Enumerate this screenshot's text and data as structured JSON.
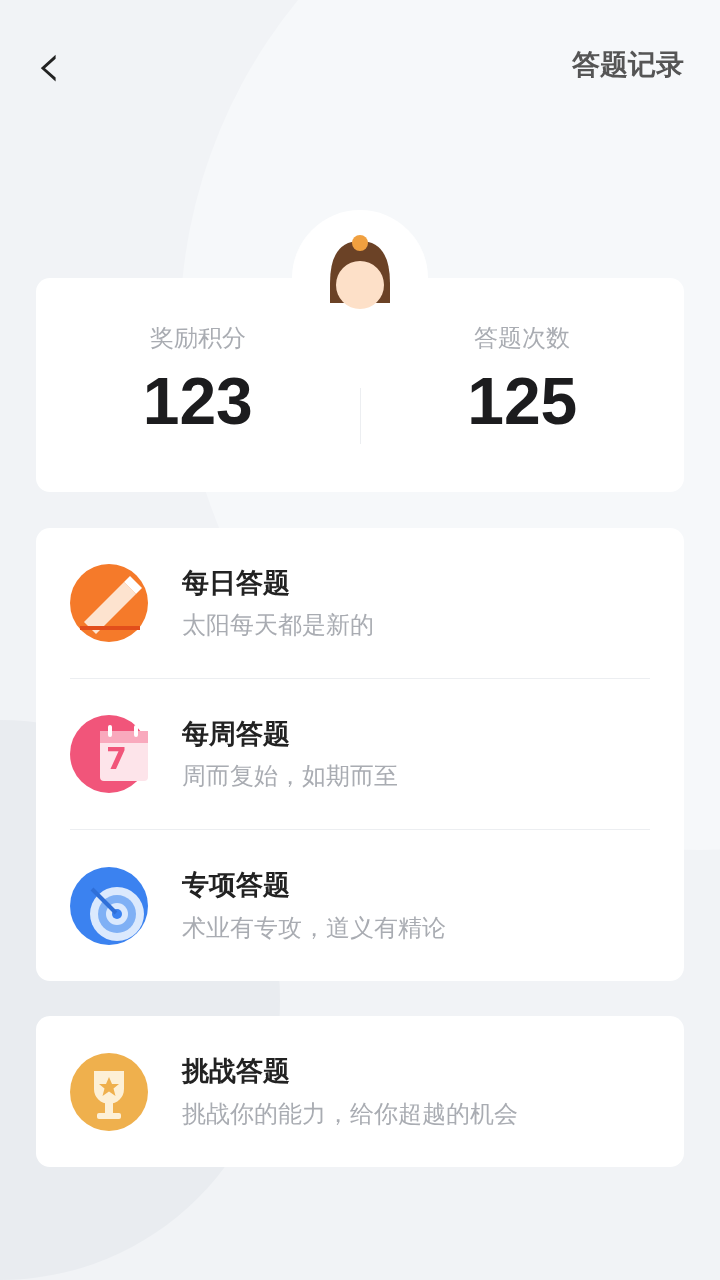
{
  "header": {
    "back": "‹",
    "action": "答题记录"
  },
  "stats": [
    {
      "label": "奖励积分",
      "value": "123"
    },
    {
      "label": "答题次数",
      "value": "125"
    }
  ],
  "modes": [
    {
      "kind": "pencil",
      "title": "每日答题",
      "subtitle": "太阳每天都是新的"
    },
    {
      "kind": "calendar",
      "title": "每周答题",
      "subtitle": "周而复始，如期而至",
      "icon_text": "7"
    },
    {
      "kind": "target",
      "title": "专项答题",
      "subtitle": "术业有专攻，道义有精论"
    }
  ],
  "challenge": {
    "kind": "trophy",
    "title": "挑战答题",
    "subtitle": "挑战你的能力，给你超越的机会"
  }
}
